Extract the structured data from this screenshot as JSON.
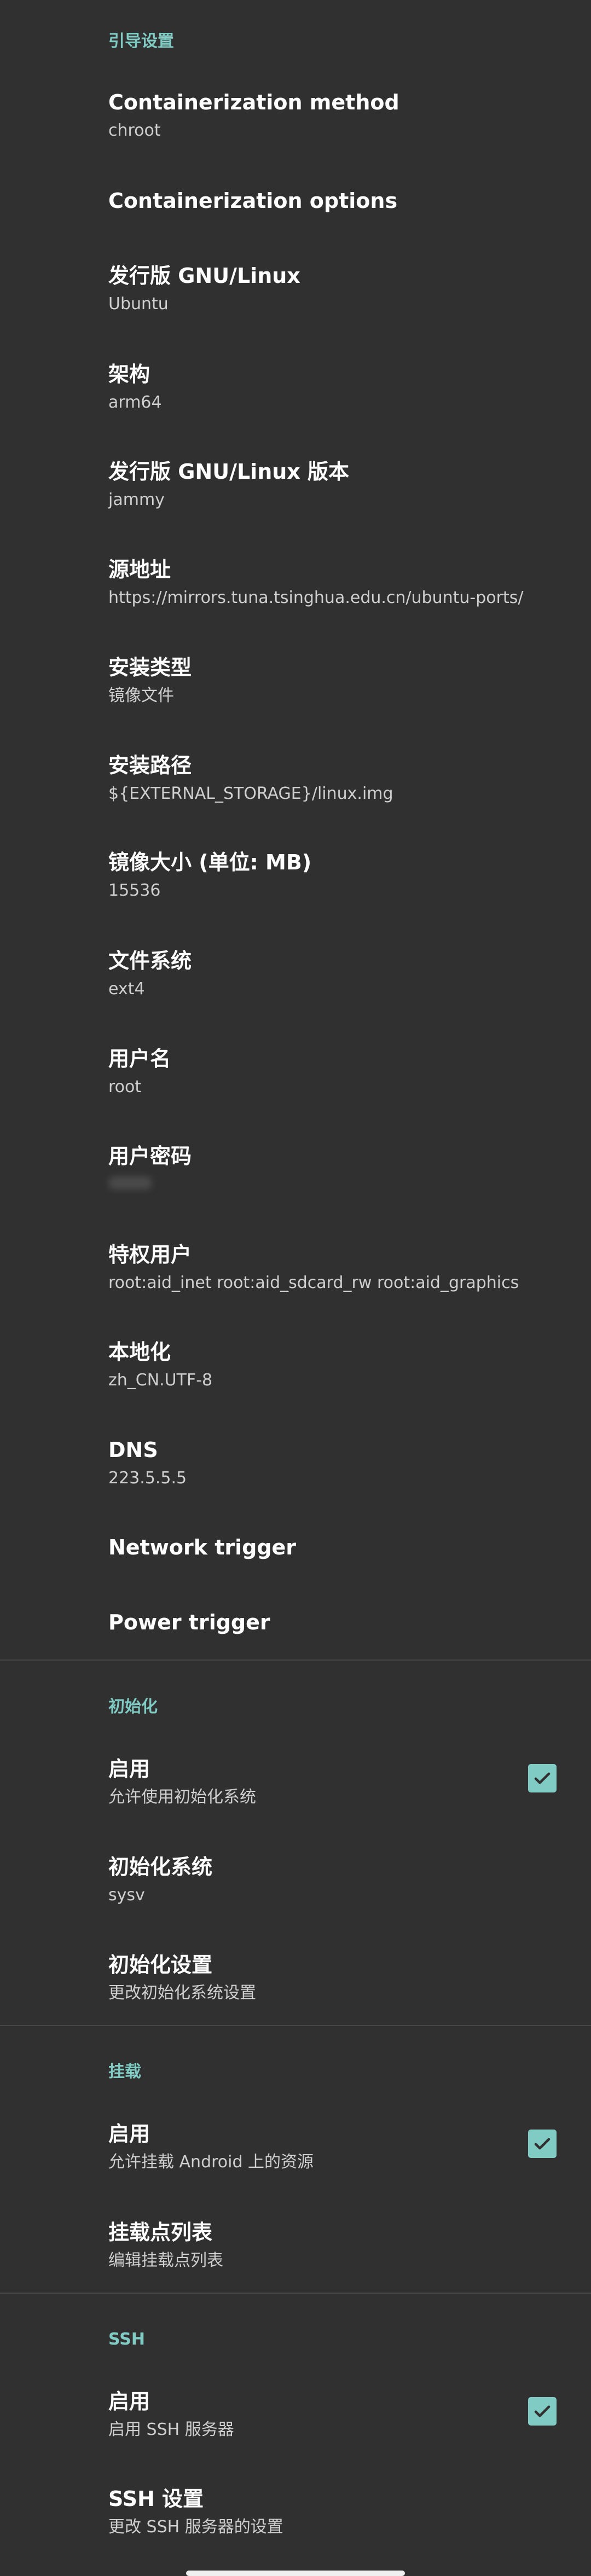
{
  "boot": {
    "header": "引导设置",
    "containerization_method": {
      "title": "Containerization method",
      "summary": "chroot"
    },
    "containerization_options": {
      "title": "Containerization options"
    },
    "distro": {
      "title": "发行版 GNU/Linux",
      "summary": "Ubuntu"
    },
    "arch": {
      "title": "架构",
      "summary": "arm64"
    },
    "distro_version": {
      "title": "发行版 GNU/Linux 版本",
      "summary": "jammy"
    },
    "source": {
      "title": "源地址",
      "summary": "https://mirrors.tuna.tsinghua.edu.cn/ubuntu-ports/"
    },
    "install_type": {
      "title": "安装类型",
      "summary": "镜像文件"
    },
    "install_path": {
      "title": "安装路径",
      "summary": "${EXTERNAL_STORAGE}/linux.img"
    },
    "image_size": {
      "title": "镜像大小 (单位: MB)",
      "summary": "15536"
    },
    "filesystem": {
      "title": "文件系统",
      "summary": "ext4"
    },
    "username": {
      "title": "用户名",
      "summary": "root"
    },
    "password": {
      "title": "用户密码"
    },
    "privileged_users": {
      "title": "特权用户",
      "summary": "root:aid_inet root:aid_sdcard_rw root:aid_graphics"
    },
    "locale": {
      "title": "本地化",
      "summary": "zh_CN.UTF-8"
    },
    "dns": {
      "title": "DNS",
      "summary": "223.5.5.5"
    },
    "network_trigger": {
      "title": "Network trigger"
    },
    "power_trigger": {
      "title": "Power trigger"
    }
  },
  "init": {
    "header": "初始化",
    "enable": {
      "title": "启用",
      "summary": "允许使用初始化系统",
      "checked": true
    },
    "init_system": {
      "title": "初始化系统",
      "summary": "sysv"
    },
    "init_settings": {
      "title": "初始化设置",
      "summary": "更改初始化系统设置"
    }
  },
  "mount": {
    "header": "挂载",
    "enable": {
      "title": "启用",
      "summary": "允许挂载 Android 上的资源",
      "checked": true
    },
    "mount_list": {
      "title": "挂载点列表",
      "summary": "编辑挂载点列表"
    }
  },
  "ssh": {
    "header": "SSH",
    "enable": {
      "title": "启用",
      "summary": "启用 SSH 服务器",
      "checked": true
    },
    "ssh_settings": {
      "title": "SSH 设置",
      "summary": "更改 SSH 服务器的设置"
    }
  },
  "colors": {
    "accent": "#80cbc4",
    "background": "#303030"
  }
}
